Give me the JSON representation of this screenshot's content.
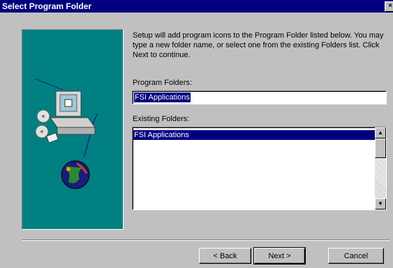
{
  "window": {
    "title": "Select Program Folder"
  },
  "intro_text": "Setup will add program icons to the Program Folder listed below.  You may type a new folder name, or select one from the existing Folders list.  Click Next to continue.",
  "program_folders": {
    "label": "Program Folders:",
    "value": "FSI Applications"
  },
  "existing_folders": {
    "label": "Existing Folders:",
    "items": [
      "FSI Applications"
    ]
  },
  "buttons": {
    "back": "< Back",
    "next": "Next >",
    "cancel": "Cancel"
  }
}
